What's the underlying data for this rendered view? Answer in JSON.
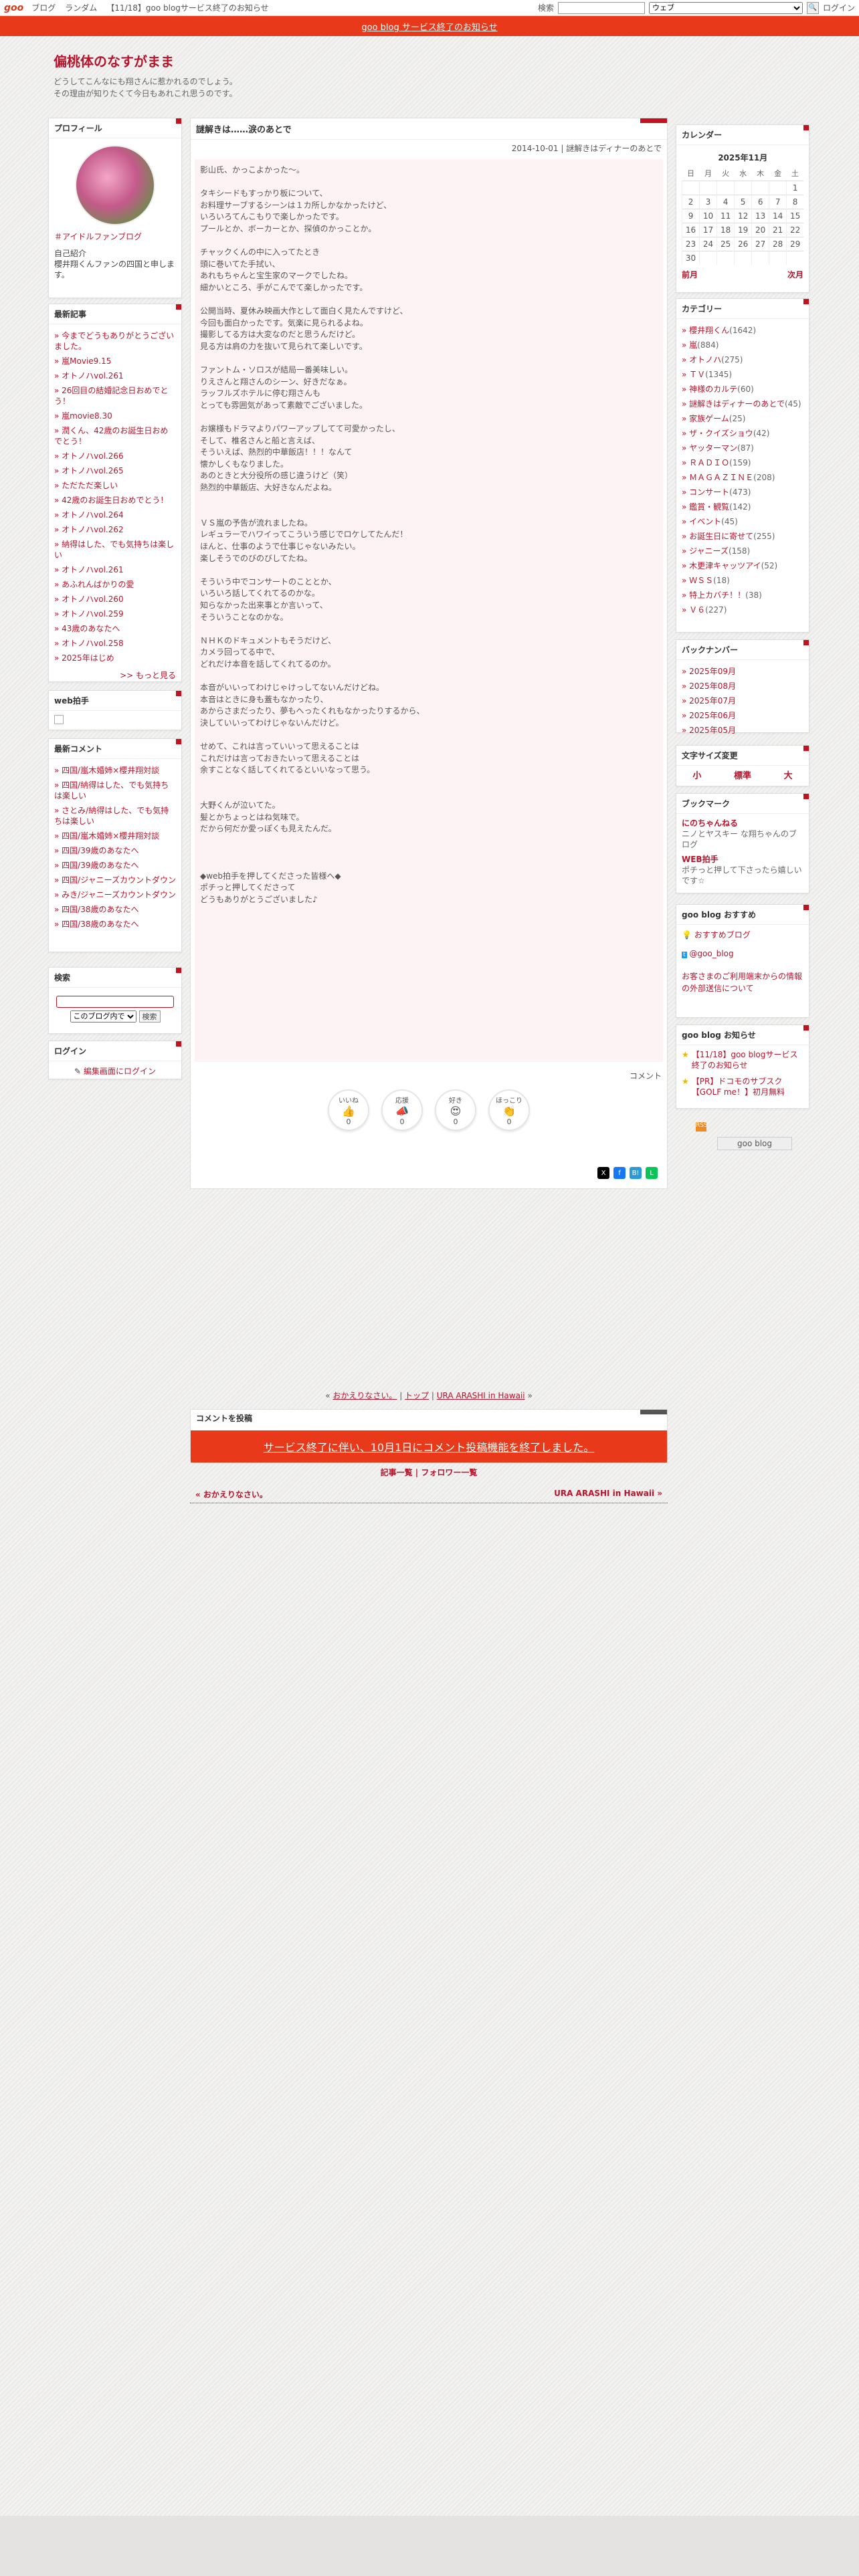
{
  "topbar": {
    "logo": "goo",
    "items": [
      "ブログ",
      "ランダム",
      "【11/18】goo blogサービス終了のお知らせ"
    ],
    "search_label": "検索",
    "search_scope": "ウェブ",
    "login": "ログイン"
  },
  "banner": "goo blog サービス終了のお知らせ",
  "header": {
    "title": "偏桃体のなすがまま",
    "desc1": "どうしてこんなにも翔さんに惹かれるのでしょう。",
    "desc2": "その理由が知りたくて今日もあれこれ思うのです。"
  },
  "profile": {
    "heading": "プロフィール",
    "fan_link": "＃アイドルファンブログ",
    "intro_label": "自己紹介",
    "intro": "櫻井翔くんファンの四国と申します。"
  },
  "recent": {
    "heading": "最新記事",
    "items": [
      "今までどうもありがとうございました。",
      "嵐Movie9.15",
      "オトノハvol.261",
      "26回目の結婚記念日おめでとう！",
      "嵐movie8.30",
      "潤くん、42歳のお誕生日おめでとう！",
      "オトノハvol.266",
      "オトノハvol.265",
      "ただただ楽しい",
      "42歳のお誕生日おめでとう！",
      "オトノハvol.264",
      "オトノハvol.262",
      "納得はした、でも気持ちは楽しい",
      "オトノハvol.261",
      "あふれんばかりの愛",
      "オトノハvol.260",
      "オトノハvol.259",
      "43歳のあなたへ",
      "オトノハvol.258",
      "2025年はじめ"
    ],
    "more": ">> もっと見る"
  },
  "web": {
    "heading": "web拍手"
  },
  "comments": {
    "heading": "最新コメント",
    "items": [
      "四国/嵐木婚姉×櫻井翔対談",
      "四国/納得はした、でも気持ちは楽しい",
      "さとみ/納得はした、でも気持ちは楽しい",
      "四国/嵐木婚姉×櫻井翔対談",
      "四国/39歳のあなたへ",
      "四国/39歳のあなたへ",
      "四国/ジャニーズカウントダウン",
      "みき/ジャニーズカウントダウン",
      "四国/38歳のあなたへ",
      "四国/38歳のあなたへ"
    ]
  },
  "search": {
    "heading": "検索",
    "scope": "このブログ内で",
    "button": "検索"
  },
  "login": {
    "heading": "ログイン",
    "link": "編集画面にログイン"
  },
  "post": {
    "title": "謎解きは……涙のあとで",
    "meta": "2014-10-01 | 謎解きはディナーのあとで",
    "body": "影山氏、かっこよかった〜。\n\nタキシードもすっかり板について、\nお料理サーブするシーンは１カ所しかなかったけど、\nいろいろてんこもりで楽しかったです。\nプールとか、ボーカーとか、探偵のかっことか。\n\nチャックくんの中に入ってたとき\n頭に巻いてた手拭い、\nあれもちゃんと宝生家のマークでしたね。\n細かいところ、手がこんでて楽しかったです。\n\n公開当時、夏休み映画大作として面白く見たんですけど、\n今回も面白かったです。気楽に見られるよね。\n撮影してる方は大変なのだと思うんだけど。\n見る方は肩の力を抜いて見られて楽しいです。\n\nファントム・ソロスが結局一番美味しい。\nりえさんと翔さんのシーン、好きだなぁ。\nラッフルズホテルに停む翔さんも\nとっても雰囲気があって素敵でございました。\n\nお嬢様もドラマよりパワーアップしてて可愛かったし、\nそして、椎名さんと船と言えば、\nそういえば、熱烈的中華飯店！！！なんて\n懐かしくもなりました。\nあのときと大分役所の感じ違うけど（笑）\n熱烈的中華飯店、大好きなんだよね。\n\n\nＶＳ嵐の予告が流れましたね。\nレギュラーでハワイってこういう感じでロケしてたんだ！\nほんと、仕事のようで仕事じゃないみたい。\n楽しそうでのびのびしてたね。\n\nそういう中でコンサートのこととか、\nいろいろ話してくれてるのかな。\n知らなかった出来事とか言いって、\nそういうことなのかな。\n\nＮＨＫのドキュメントもそうだけど、\nカメラ回ってる中で、\nどれだけ本音を話してくれてるのか。\n\n本音がいいってわけじゃけっしてないんだけどね。\n本音はときに身も蓋もなかったり、\nあからさまだったり、夢もへったくれもなかったりするから、\n決していいってわけじゃないんだけど。\n\nせめて、これは言っていいって思えることは\nこれだけは言っておきたいって思えることは\n余すことなく話してくれてるといいなって思う。\n\n\n大野くんが泣いてた。\n髪とかちょっとはね気味で。\nだから何だか愛っぽくも見えたんだ。\n\n\n\n◆web拍手を押してくださった皆様へ◆\nポチっと押してくださって\nどうもありがとうございました♪",
    "comment_label": "コメント",
    "reactions": [
      {
        "em": "👍",
        "label": "いいね",
        "count": "0"
      },
      {
        "em": "📣",
        "label": "応援",
        "count": "0"
      },
      {
        "em": "😍",
        "label": "好き",
        "count": "0"
      },
      {
        "em": "👏",
        "label": "ほっこり",
        "count": "0"
      }
    ]
  },
  "bottom": {
    "prev": "おかえりなさい。",
    "top": "トップ",
    "next": "URA ARASHI in Hawaii",
    "comment_heading": "コメントを投稿",
    "comment_end": "サービス終了に伴い、10月1日にコメント投稿機能を終了しました。",
    "list_links": "記事一覧 | フォロワー一覧",
    "prev_link": "« おかえりなさい。",
    "next_link": "URA ARASHI in Hawaii »"
  },
  "calendar": {
    "heading": "カレンダー",
    "month": "2025年11月",
    "weekdays": [
      "日",
      "月",
      "火",
      "水",
      "木",
      "金",
      "土"
    ],
    "weeks": [
      [
        "",
        "",
        "",
        "",
        "",
        "",
        "1"
      ],
      [
        "2",
        "3",
        "4",
        "5",
        "6",
        "7",
        "8"
      ],
      [
        "9",
        "10",
        "11",
        "12",
        "13",
        "14",
        "15"
      ],
      [
        "16",
        "17",
        "18",
        "19",
        "20",
        "21",
        "22"
      ],
      [
        "23",
        "24",
        "25",
        "26",
        "27",
        "28",
        "29"
      ],
      [
        "30",
        "",
        "",
        "",
        "",
        "",
        ""
      ]
    ],
    "prev": "前月",
    "next": "次月"
  },
  "categories": {
    "heading": "カテゴリー",
    "items": [
      [
        "櫻井翔くん",
        "(1642)"
      ],
      [
        "嵐",
        "(884)"
      ],
      [
        "オトノハ",
        "(275)"
      ],
      [
        "ＴＶ",
        "(1345)"
      ],
      [
        "神様のカルテ",
        "(60)"
      ],
      [
        "謎解きはディナーのあとで",
        "(45)"
      ],
      [
        "家族ゲーム",
        "(25)"
      ],
      [
        "ザ・クイズショウ",
        "(42)"
      ],
      [
        "ヤッターマン",
        "(87)"
      ],
      [
        "ＲＡＤＩＯ",
        "(159)"
      ],
      [
        "ＭＡＧＡＺＩＮＥ",
        "(208)"
      ],
      [
        "コンサート",
        "(473)"
      ],
      [
        "鑑賞・観覧",
        "(142)"
      ],
      [
        "イベント",
        "(45)"
      ],
      [
        "お誕生日に寄せて",
        "(255)"
      ],
      [
        "ジャニーズ",
        "(158)"
      ],
      [
        "木更津キャッツアイ",
        "(52)"
      ],
      [
        "ＷＳＳ",
        "(18)"
      ],
      [
        "特上カバチ！！",
        "(38)"
      ],
      [
        "Ｖ６",
        "(227)"
      ]
    ]
  },
  "backnumber": {
    "heading": "バックナンバー",
    "items": [
      "2025年09月",
      "2025年08月",
      "2025年07月",
      "2025年06月",
      "2025年05月"
    ]
  },
  "fontsize": {
    "heading": "文字サイズ変更",
    "small": "小",
    "normal": "標準",
    "large": "大"
  },
  "bookmark": {
    "heading": "ブックマーク",
    "b1_title": "にのちゃんねる",
    "b1_desc": "ニノとヤスキー な翔ちゃんのブログ",
    "b2_title": "WEB拍手",
    "b2_desc": "ポチっと押して下さったら嬉しいです☆"
  },
  "recommend": {
    "heading": "goo blog おすすめ",
    "item1": "おすすめブログ",
    "item2": "@goo_blog",
    "notice": "お客さまのご利用端末からの情報の外部送信について"
  },
  "notice": {
    "heading": "goo blog お知らせ",
    "item1": "【11/18】goo blogサービス終了のお知らせ",
    "item2": "【PR】ドコモのサブスク【GOLF me！】初月無料"
  },
  "badge": "goo blog",
  "colors": {
    "accent": "#b8142b",
    "banner": "#e8391a"
  }
}
